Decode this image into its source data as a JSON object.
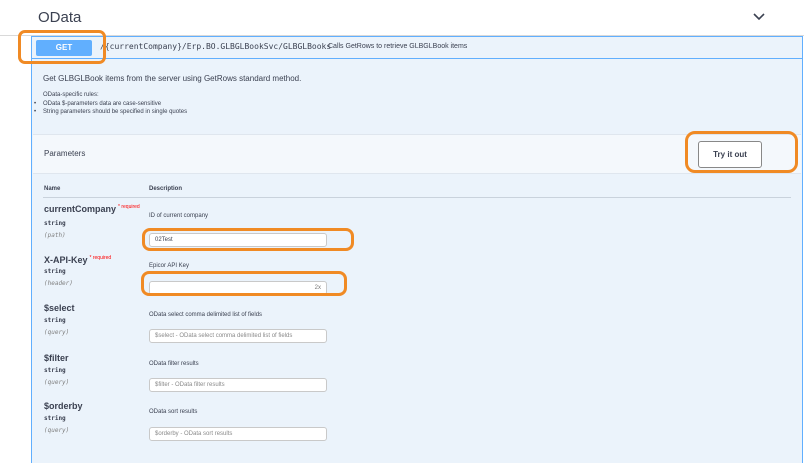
{
  "section": {
    "title": "OData"
  },
  "operation": {
    "method": "GET",
    "path": "/{currentCompany}/Erp.BO.GLBGLBookSvc/GLBGLBooks",
    "summary": "Calls GetRows to retrieve GLBGLBook items",
    "description": "Get GLBGLBook items from the server using GetRows standard method.",
    "rules_title": "OData-specific rules:",
    "rules": [
      "OData $-parameters data are case-sensitive",
      "String parameters should be specified in single quotes"
    ]
  },
  "parameters": {
    "title": "Parameters",
    "try_label": "Try it out",
    "col_name": "Name",
    "col_description": "Description",
    "required_label": "* required",
    "items": [
      {
        "name": "currentCompany",
        "type": "string",
        "in": "(path)",
        "description": "ID of current company",
        "value": "02Test",
        "placeholder": ""
      },
      {
        "name": "X-API-Key",
        "type": "string",
        "in": "(header)",
        "description": "Epicor API Key",
        "value": "",
        "placeholder": ""
      },
      {
        "name": "$select",
        "type": "string",
        "in": "(query)",
        "description": "OData select comma delimited list of fields",
        "value": "",
        "placeholder": "$select - OData select comma delimited list of fields"
      },
      {
        "name": "$filter",
        "type": "string",
        "in": "(query)",
        "description": "OData filter results",
        "value": "",
        "placeholder": "$filter - OData filter results"
      },
      {
        "name": "$orderby",
        "type": "string",
        "in": "(query)",
        "description": "OData sort results",
        "value": "",
        "placeholder": "$orderby - OData sort results"
      }
    ]
  },
  "colors": {
    "accent": "#61affe",
    "highlight": "#f08a24",
    "required": "#ff0000"
  },
  "icons": {
    "collapse": "chevron-down-icon",
    "clear": "clear-icon"
  }
}
